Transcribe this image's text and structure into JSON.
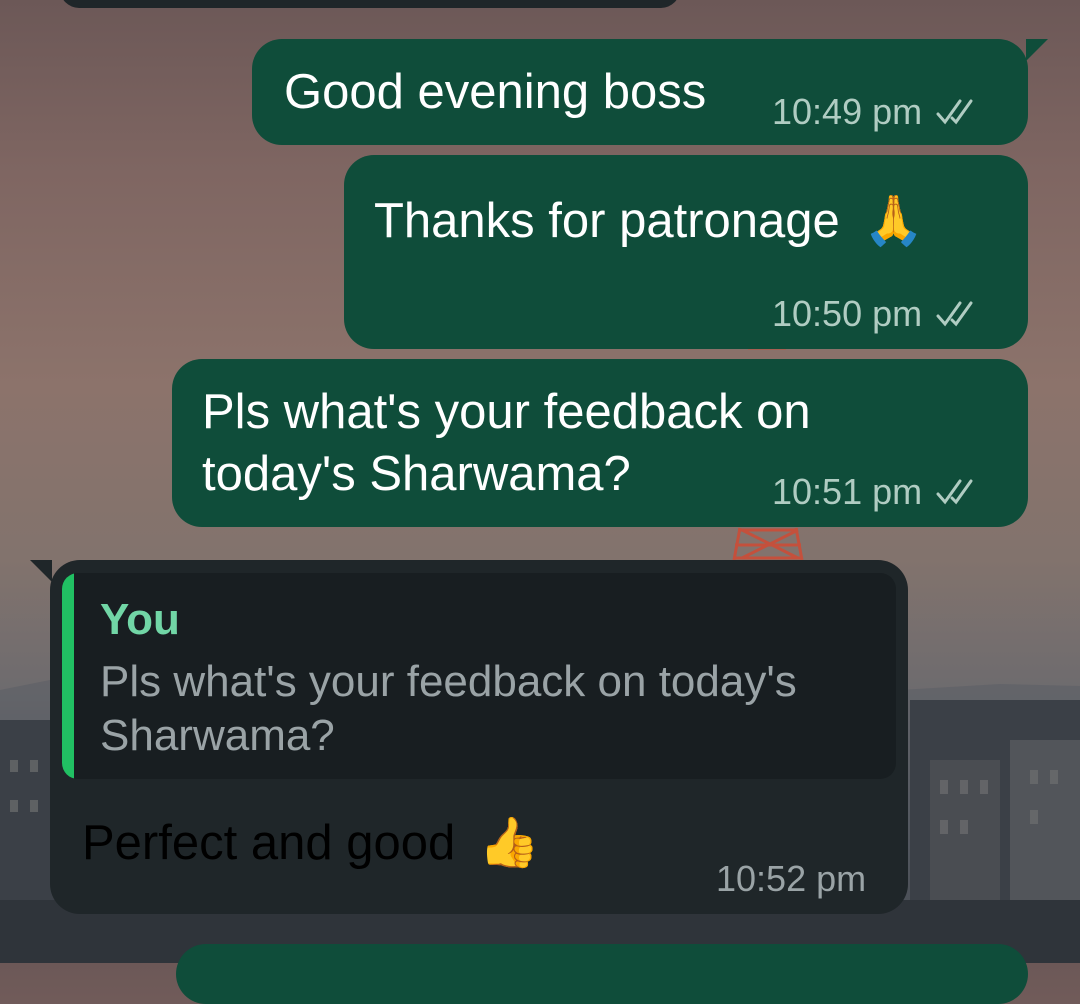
{
  "colors": {
    "outgoing_bubble": "#0f4d3a",
    "incoming_bubble": "#1f2629",
    "read_ticks": "#b0ccc2",
    "quote_bar": "#21c063",
    "quote_author": "#71d6a6"
  },
  "messages": [
    {
      "direction": "outgoing",
      "text": "Good evening boss",
      "time": "10:49 pm",
      "status_icon": "double-check-icon"
    },
    {
      "direction": "outgoing",
      "text": "Thanks for patronage",
      "emoji": "🙏",
      "time": "10:50 pm",
      "status_icon": "double-check-icon"
    },
    {
      "direction": "outgoing",
      "text_line1": "Pls what's your feedback on",
      "text_line2": "today's Sharwama?",
      "time": "10:51 pm",
      "status_icon": "double-check-icon"
    },
    {
      "direction": "incoming",
      "reply_to": {
        "author": "You",
        "text": "Pls what's your feedback on today's Sharwama?"
      },
      "text": "Perfect and good",
      "emoji": "👍",
      "time": "10:52 pm"
    }
  ]
}
